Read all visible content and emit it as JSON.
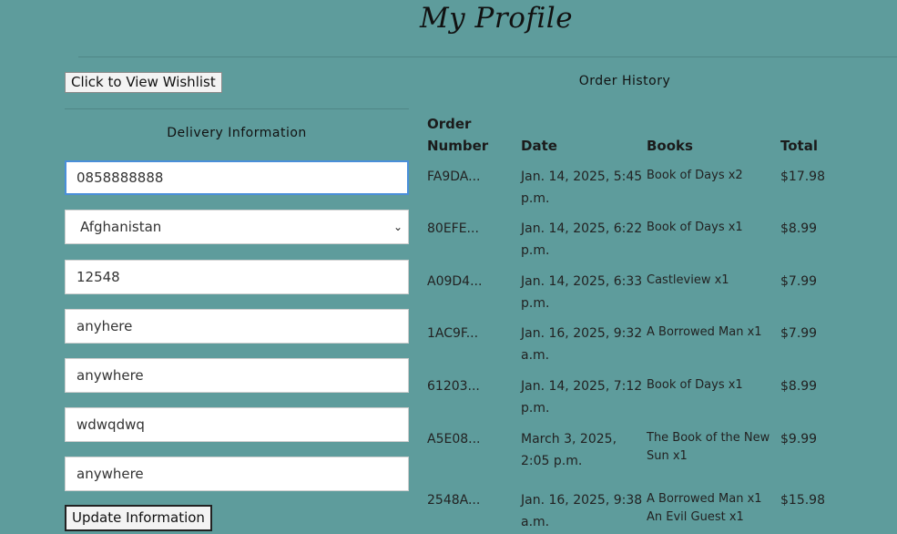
{
  "page": {
    "title": "My Profile"
  },
  "wishlist_button": "Click to View Wishlist",
  "delivery": {
    "title": "Delivery Information",
    "fields": [
      {
        "value": "0858888888"
      },
      {
        "value": "Afghanistan"
      },
      {
        "value": "12548"
      },
      {
        "value": "anyhere"
      },
      {
        "value": "anywhere"
      },
      {
        "value": "wdwqdwq"
      },
      {
        "value": "anywhere"
      }
    ],
    "update_button": "Update Information"
  },
  "orders": {
    "title": "Order History",
    "headers": {
      "order_number_1": "Order",
      "order_number_2": "Number",
      "date": "Date",
      "books": "Books",
      "total": "Total"
    },
    "rows": [
      {
        "number": "FA9DA...",
        "date_1": "Jan. 14, 2025, 5:45",
        "date_2": "p.m.",
        "books_1": "Book of Days x2",
        "books_2": "",
        "total": "$17.98"
      },
      {
        "number": "80EFE...",
        "date_1": "Jan. 14, 2025, 6:22",
        "date_2": "p.m.",
        "books_1": "Book of Days x1",
        "books_2": "",
        "total": "$8.99"
      },
      {
        "number": "A09D4...",
        "date_1": "Jan. 14, 2025, 6:33",
        "date_2": "p.m.",
        "books_1": "Castleview x1",
        "books_2": "",
        "total": "$7.99"
      },
      {
        "number": "1AC9F...",
        "date_1": "Jan. 16, 2025, 9:32",
        "date_2": "a.m.",
        "books_1": "A Borrowed Man x1",
        "books_2": "",
        "total": "$7.99"
      },
      {
        "number": "61203...",
        "date_1": "Jan. 14, 2025, 7:12",
        "date_2": "p.m.",
        "books_1": "Book of Days x1",
        "books_2": "",
        "total": "$8.99"
      },
      {
        "number": "A5E08...",
        "date_1": "March 3, 2025,",
        "date_2": "2:05 p.m.",
        "books_1": "The Book of the New",
        "books_2": "Sun x1",
        "total": "$9.99"
      },
      {
        "number": "2548A...",
        "date_1": "Jan. 16, 2025, 9:38",
        "date_2": "a.m.",
        "books_1": "A Borrowed Man x1",
        "books_2": "An Evil Guest x1",
        "total": "$15.98"
      }
    ]
  }
}
